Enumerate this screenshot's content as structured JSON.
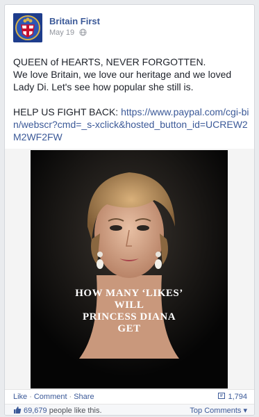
{
  "post": {
    "page_name": "Britain First",
    "date": "May 19",
    "privacy_icon": "globe-icon",
    "lines": [
      "QUEEN of HEARTS, NEVER FORGOTTEN.",
      "We love Britain, we love our heritage and we loved Lady Di. Let's see how popular she still is."
    ],
    "cta_prefix": "HELP US FIGHT BACK:",
    "cta_link": "https://www.paypal.com/cgi-bin/webscr?cmd=_s-xclick&hosted_button_id=UCREW2M2WF2FW"
  },
  "image": {
    "overlay_lines": [
      "HOW MANY ‘LIKES’",
      "WILL",
      "PRINCESS DIANA",
      "GET"
    ]
  },
  "actions": {
    "like": "Like",
    "comment": "Comment",
    "share": "Share",
    "share_count": "1,794"
  },
  "likes_bar": {
    "count": "69,679",
    "suffix": "people like this.",
    "sort_label": "Top Comments"
  },
  "colors": {
    "link_blue": "#3b5998",
    "text": "#1d2129",
    "meta_gray": "#90949c",
    "background": "#e9ebee"
  }
}
